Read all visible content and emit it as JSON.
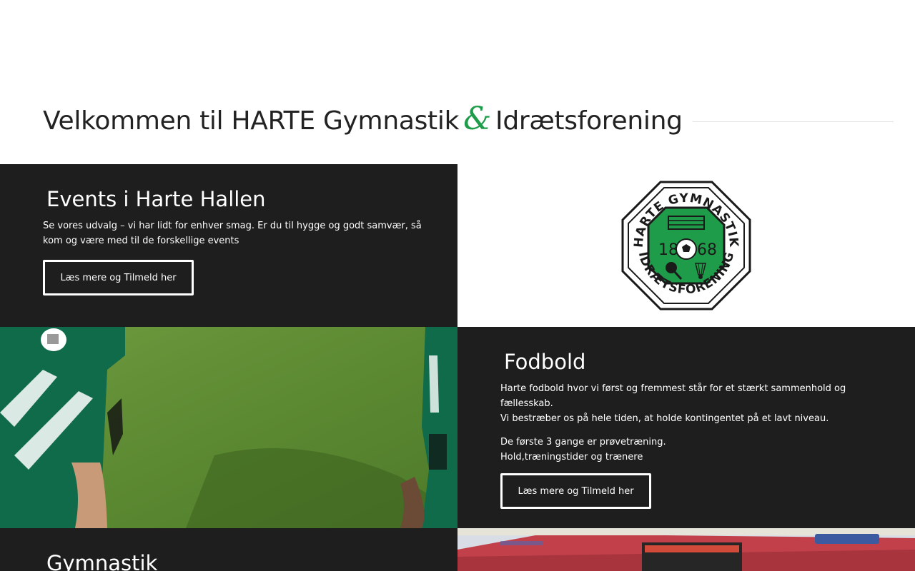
{
  "welcome": {
    "title_part1": "Velkommen til HARTE Gymnastik",
    "ampersand": "&",
    "title_part2": "Idrætsforening"
  },
  "events": {
    "heading": "Events i Harte Hallen",
    "text": "Se vores udvalg – vi har lidt for enhver smag. Er du til hygge og godt samvær, så kom og være med til de forskellige events",
    "button_label": "Læs mere og Tilmeld her"
  },
  "logo": {
    "icon": "harte-club-logo",
    "text_top": "HARTE GYMNASTIK",
    "text_bottom": "IDRÆTSFORENING",
    "year_left": "18",
    "year_right": "68",
    "colors": {
      "green": "#1f9c4a",
      "dark": "#1a1a1a"
    }
  },
  "fodbold": {
    "heading": "Fodbold",
    "text_line1": "Harte fodbold hvor vi først og fremmest står for et stærkt sammenhold og fællesskab.",
    "text_line2": "Vi bestræber os på hele tiden, at holde kontingentet på et lavt niveau.",
    "text_line3": "De første 3 gange er prøvetræning.",
    "text_line4": "Hold,træningstider og trænere",
    "button_label": "Læs mere og Tilmeld her"
  },
  "gymnastik": {
    "heading": "Gymnastik"
  },
  "colors": {
    "dark_panel": "#1e1e1e",
    "accent_green": "#1f9c4a"
  }
}
